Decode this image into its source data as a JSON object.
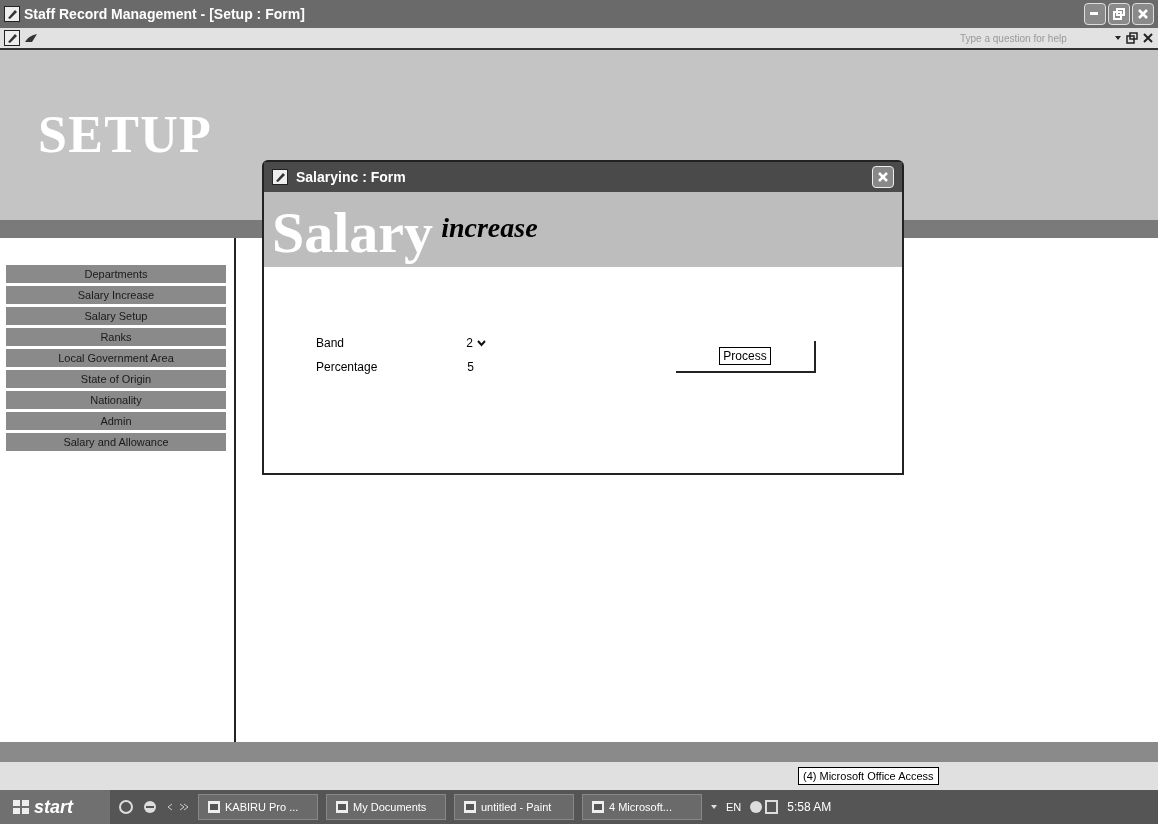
{
  "window": {
    "title": "Staff Record Management - [Setup : Form]"
  },
  "help_box": {
    "placeholder": "Type a question for help"
  },
  "header": {
    "title": "SETUP"
  },
  "sidebar": {
    "items": [
      "Departments",
      "Salary Increase",
      "Salary Setup",
      "Ranks",
      "Local Government Area",
      "State of Origin",
      "Nationality",
      "Admin",
      "Salary and Allowance"
    ]
  },
  "dialog": {
    "title": "Salaryinc : Form",
    "heading": "Salary",
    "heading_script": "increase",
    "fields": [
      {
        "label": "Band",
        "value": "2",
        "kind": "dropdown"
      },
      {
        "label": "Percentage",
        "value": "5",
        "kind": "text"
      }
    ],
    "button": "Process"
  },
  "tooltip": "(4) Microsoft Office Access",
  "taskbar": {
    "start": "start",
    "tasks": [
      "KABIRU Pro ...",
      "My Documents",
      "untitled - Paint",
      "4 Microsoft..."
    ],
    "language": "EN",
    "clock": "5:58 AM"
  }
}
